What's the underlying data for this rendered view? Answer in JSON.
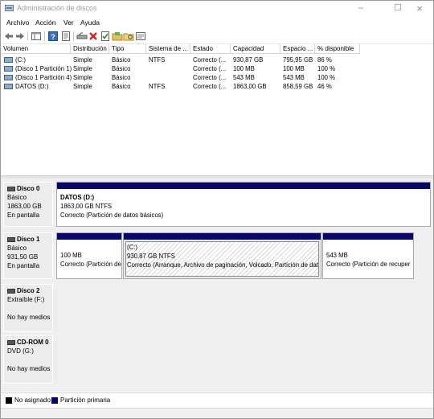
{
  "window": {
    "title": "Administración de discos"
  },
  "menu": [
    "Archivo",
    "Acción",
    "Ver",
    "Ayuda"
  ],
  "volume_table": {
    "columns": [
      "Volumen",
      "Distribución",
      "Tipo",
      "Sistema de ...",
      "Estado",
      "Capacidad",
      "Espacio ...",
      "% disponible"
    ],
    "rows": [
      [
        "(C:)",
        "Simple",
        "Básico",
        "NTFS",
        "Correcto (...",
        "930,87 GB",
        "795,95 GB",
        "86 %"
      ],
      [
        "(Disco 1 Partición 1)",
        "Simple",
        "Básico",
        "",
        "Correcto (...",
        "100 MB",
        "100 MB",
        "100 %"
      ],
      [
        "(Disco 1 Partición 4)",
        "Simple",
        "Básico",
        "",
        "Correcto (...",
        "543 MB",
        "543 MB",
        "100 %"
      ],
      [
        "DATOS (D:)",
        "Simple",
        "Básico",
        "NTFS",
        "Correcto (...",
        "1863,00 GB",
        "858,59 GB",
        "46 %"
      ]
    ]
  },
  "disks": [
    {
      "name": "Disco 0",
      "type": "Básico",
      "size": "1863,00 GB",
      "status": "En pantalla",
      "partitions": [
        {
          "title": "DATOS  (D:)",
          "line1": "1863,00 GB NTFS",
          "line2": "Correcto (Partición de datos básicos)"
        }
      ]
    },
    {
      "name": "Disco 1",
      "type": "Básico",
      "size": "931,50 GB",
      "status": "En pantalla",
      "partitions": [
        {
          "title": "",
          "line1": "100 MB",
          "line2": "Correcto (Partición de"
        },
        {
          "title": "(C:)",
          "line1": "930,87 GB NTFS",
          "line2": "Correcto (Arranque, Archivo de paginación, Volcado, Partición de dat"
        },
        {
          "title": "",
          "line1": "543 MB",
          "line2": "Correcto (Partición de recuper"
        }
      ]
    },
    {
      "name": "Disco 2",
      "type": "Extraíble (F:)",
      "size": "",
      "status": "No hay medios",
      "partitions": []
    },
    {
      "name": "CD-ROM 0",
      "type": "DVD (G:)",
      "size": "",
      "status": "No hay medios",
      "partitions": []
    }
  ],
  "legend": [
    {
      "label": "No asignado",
      "color": "#000000"
    },
    {
      "label": "Partición primaria",
      "color": "#06066e"
    }
  ]
}
